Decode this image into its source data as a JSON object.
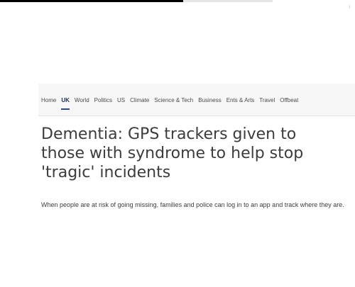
{
  "nav": {
    "items": [
      {
        "label": "Home"
      },
      {
        "label": "UK",
        "active": true
      },
      {
        "label": "World"
      },
      {
        "label": "Politics"
      },
      {
        "label": "US"
      },
      {
        "label": "Climate"
      },
      {
        "label": "Science & Tech"
      },
      {
        "label": "Business"
      },
      {
        "label": "Ents & Arts"
      },
      {
        "label": "Travel"
      },
      {
        "label": "Offbeat"
      }
    ]
  },
  "article": {
    "headline": "Dementia: GPS trackers given to those with syndrome to help stop 'tragic' incidents",
    "standfirst": "When people are at risk of going missing, families and police can log in to an app and track where they are."
  },
  "colors": {
    "active_underline": "#2b4a92",
    "text": "#3c3c3c",
    "nav_background": "#f7f7f7"
  }
}
